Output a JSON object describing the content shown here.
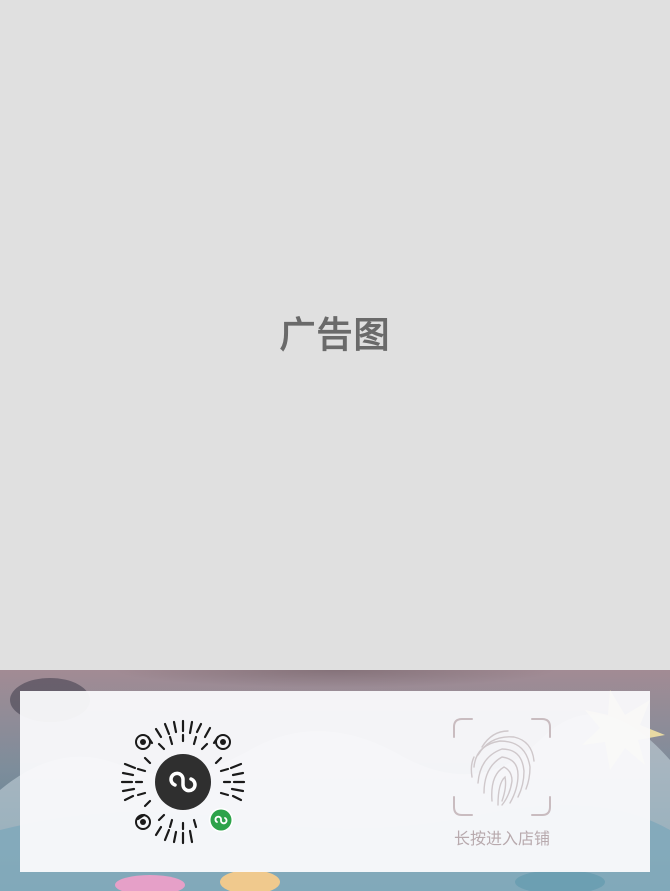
{
  "ad": {
    "label": "广告图"
  },
  "qr": {
    "icon": "mini-program-icon"
  },
  "fingerprint": {
    "icon": "fingerprint-icon",
    "caption": "长按进入店铺"
  },
  "colors": {
    "placeholder_bg": "#e0e0e0",
    "placeholder_text": "#6a6a6a",
    "caption_text": "#b8aaae",
    "mini_program_green": "#2da34a"
  }
}
